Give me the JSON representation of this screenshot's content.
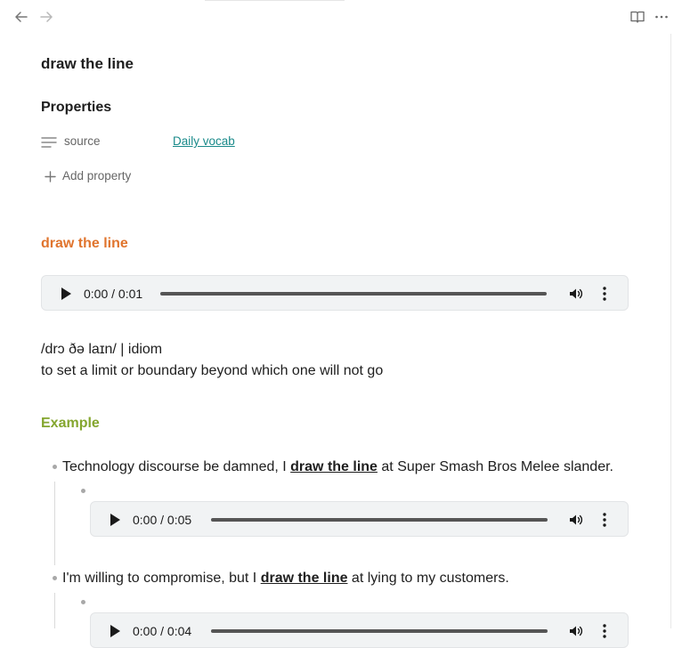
{
  "note": {
    "title": "draw the line",
    "properties_heading": "Properties",
    "property": {
      "key": "source",
      "value": "Daily vocab"
    },
    "add_property_label": "Add property"
  },
  "word_heading": "draw the line",
  "main_audio": {
    "time": "0:00 / 0:01"
  },
  "pronunciation": "/drɔ ðə laɪn/ | idiom",
  "definition": "to set a limit or boundary beyond which one will not go",
  "example_heading": "Example",
  "examples": [
    {
      "before": "Technology discourse be damned, I ",
      "phrase": "draw the line",
      "after": " at Super Smash Bros Melee slander.",
      "audio_time": "0:00 / 0:05"
    },
    {
      "before": "I'm willing to compromise, but I ",
      "phrase": "draw the line",
      "after": " at lying to my customers.",
      "audio_time": "0:00 / 0:04"
    }
  ],
  "colors": {
    "heading_orange": "#e0742d",
    "heading_green": "#84a62e",
    "link_teal": "#1a8a8a"
  },
  "icons": [
    "back-arrow-icon",
    "forward-arrow-icon",
    "reading-view-icon",
    "more-options-icon",
    "text-lines-icon",
    "plus-icon",
    "play-icon",
    "volume-icon",
    "kebab-menu-icon"
  ]
}
